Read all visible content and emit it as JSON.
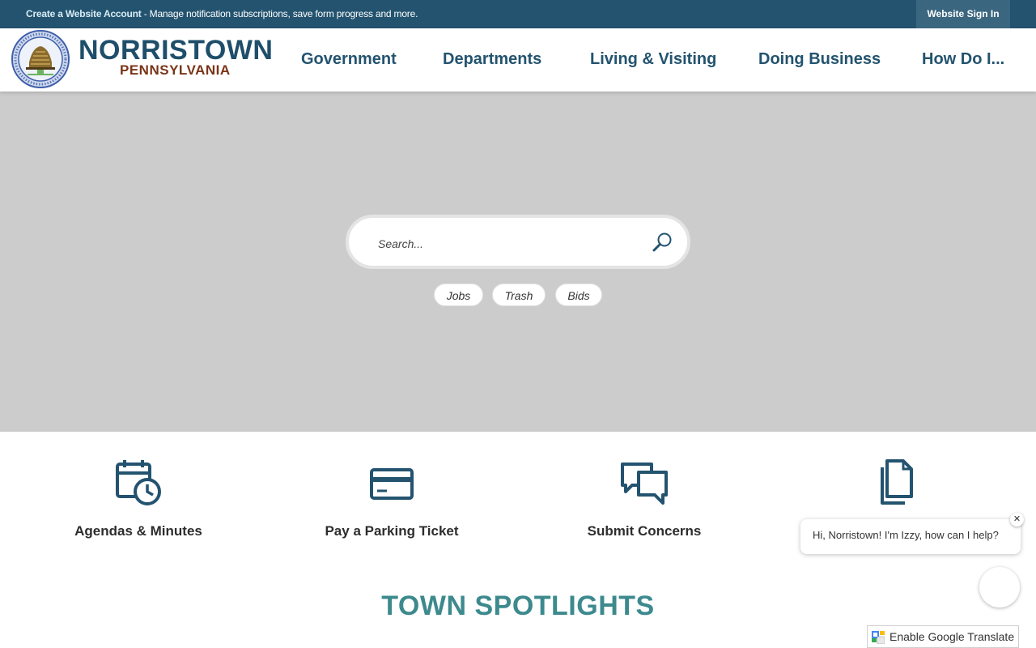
{
  "topbar": {
    "create_link": "Create a Website Account",
    "create_desc": " - Manage notification subscriptions, save form progress and more.",
    "signin": "Website Sign In"
  },
  "brand": {
    "name": "NORRISTOWN",
    "sub": "PENNSYLVANIA",
    "seal_icon": "municipal-seal-icon"
  },
  "nav": [
    {
      "label": "Government"
    },
    {
      "label": "Departments"
    },
    {
      "label": "Living & Visiting"
    },
    {
      "label": "Doing Business"
    },
    {
      "label": "How Do I..."
    }
  ],
  "search": {
    "placeholder": "Search...",
    "icon": "search-icon"
  },
  "chips": [
    "Jobs",
    "Trash",
    "Bids"
  ],
  "quicklinks": [
    {
      "label": "Agendas & Minutes",
      "icon": "calendar-clock-icon"
    },
    {
      "label": "Pay a Parking Ticket",
      "icon": "credit-card-icon"
    },
    {
      "label": "Submit Concerns",
      "icon": "chat-bubbles-icon"
    },
    {
      "label": "",
      "icon": "documents-icon"
    }
  ],
  "spotlights_title": "TOWN SPOTLIGHTS",
  "chat": {
    "message": "Hi, Norristown! I'm Izzy, how can I help?",
    "close": "✕"
  },
  "translate": {
    "label": "Enable Google Translate"
  },
  "colors": {
    "topbar": "#23536f",
    "accent": "#1e4e6a",
    "brand_sub": "#7a3418",
    "hero": "#cccccc",
    "spotlight": "#3d8a8e"
  }
}
